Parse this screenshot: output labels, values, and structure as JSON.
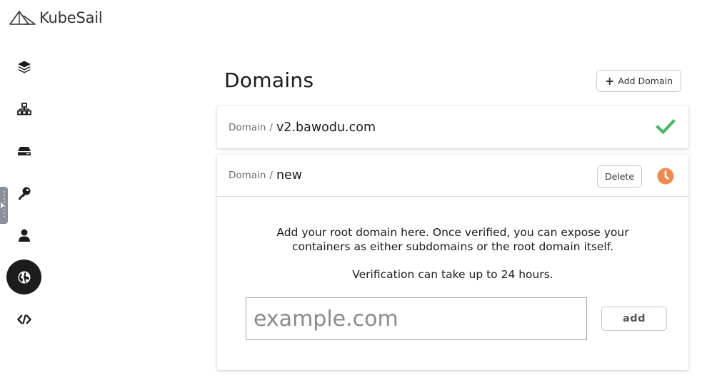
{
  "app": {
    "logo_text": "KubeSail"
  },
  "nav": {
    "items": [
      {
        "icon": "layers-icon",
        "active": false
      },
      {
        "icon": "network-icon",
        "active": false
      },
      {
        "icon": "drive-icon",
        "active": false
      },
      {
        "icon": "key-icon",
        "active": false
      },
      {
        "icon": "user-icon",
        "active": false
      },
      {
        "icon": "globe-icon",
        "active": true
      },
      {
        "icon": "code-icon",
        "active": false
      }
    ]
  },
  "header": {
    "title": "Domains",
    "add_domain_label": "Add Domain"
  },
  "domains": [
    {
      "label": "Domain",
      "separator": "/",
      "name": "v2.bawodu.com",
      "status": "verified",
      "status_icon": "check-icon",
      "status_color": "#4ab866"
    },
    {
      "label": "Domain",
      "separator": "/",
      "name": "new",
      "status": "pending",
      "status_icon": "clock-icon",
      "status_color": "#f0894e",
      "delete_label": "Delete",
      "message_line1": "Add your root domain here. Once verified, you can expose your",
      "message_line2": "containers as either subdomains or the root domain itself.",
      "message_note": "Verification can take up to 24 hours.",
      "input_value": "",
      "input_placeholder": "example.com",
      "add_label": "add"
    }
  ]
}
